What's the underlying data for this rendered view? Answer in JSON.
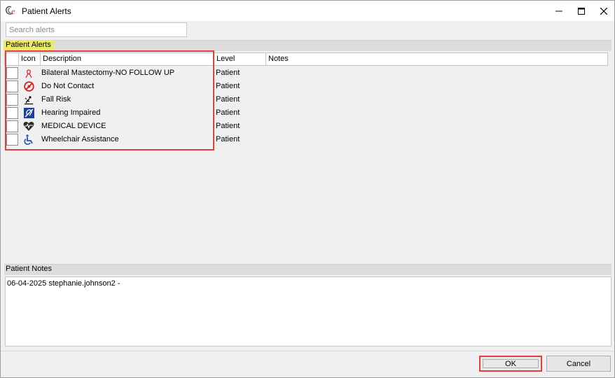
{
  "window": {
    "title": "Patient Alerts",
    "app_icon": "ce-logo-icon",
    "controls": [
      "minimize-icon",
      "maximize-icon",
      "close-icon"
    ]
  },
  "search": {
    "placeholder": "Search alerts",
    "value": ""
  },
  "alerts": {
    "section_label": "Patient Alerts",
    "columns": [
      "Icon",
      "Description",
      "Level",
      "Notes"
    ],
    "rows": [
      {
        "checked": false,
        "icon": "ribbon-icon",
        "description": "Bilateral Mastectomy-NO FOLLOW UP",
        "level": "Patient",
        "notes": ""
      },
      {
        "checked": false,
        "icon": "no-contact-icon",
        "description": "Do Not Contact",
        "level": "Patient",
        "notes": ""
      },
      {
        "checked": false,
        "icon": "fall-risk-icon",
        "description": "Fall Risk",
        "level": "Patient",
        "notes": ""
      },
      {
        "checked": false,
        "icon": "hearing-impaired-icon",
        "description": "Hearing Impaired",
        "level": "Patient",
        "notes": ""
      },
      {
        "checked": false,
        "icon": "heart-device-icon",
        "description": "MEDICAL DEVICE",
        "level": "Patient",
        "notes": ""
      },
      {
        "checked": false,
        "icon": "wheelchair-icon",
        "description": "Wheelchair Assistance",
        "level": "Patient",
        "notes": ""
      }
    ]
  },
  "notes": {
    "section_label": "Patient Notes",
    "text": "06-04-2025 stephanie.johnson2 -"
  },
  "buttons": {
    "ok": "OK",
    "cancel": "Cancel"
  },
  "colors": {
    "highlight_red": "#e0413f",
    "label_yellow": "#ecea60",
    "icon_red": "#d81c1c",
    "icon_blue": "#1a3f9e"
  }
}
